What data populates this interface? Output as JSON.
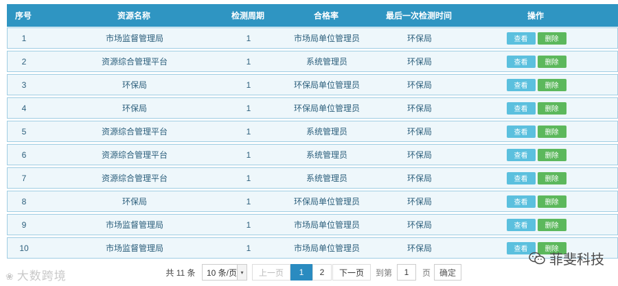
{
  "table": {
    "headers": [
      "序号",
      "资源名称",
      "检测周期",
      "合格率",
      "最后一次检测时间",
      "操作"
    ],
    "view_label": "查看",
    "delete_label": "删除",
    "rows": [
      {
        "no": "1",
        "name": "市场监督管理局",
        "cycle": "1",
        "rate": "市场局单位管理员",
        "last": "环保局"
      },
      {
        "no": "2",
        "name": "资源综合管理平台",
        "cycle": "1",
        "rate": "系统管理员",
        "last": "环保局"
      },
      {
        "no": "3",
        "name": "环保局",
        "cycle": "1",
        "rate": "环保局单位管理员",
        "last": "环保局"
      },
      {
        "no": "4",
        "name": "环保局",
        "cycle": "1",
        "rate": "环保局单位管理员",
        "last": "环保局"
      },
      {
        "no": "5",
        "name": "资源综合管理平台",
        "cycle": "1",
        "rate": "系统管理员",
        "last": "环保局"
      },
      {
        "no": "6",
        "name": "资源综合管理平台",
        "cycle": "1",
        "rate": "系统管理员",
        "last": "环保局"
      },
      {
        "no": "7",
        "name": "资源综合管理平台",
        "cycle": "1",
        "rate": "系统管理员",
        "last": "环保局"
      },
      {
        "no": "8",
        "name": "环保局",
        "cycle": "1",
        "rate": "环保局单位管理员",
        "last": "环保局"
      },
      {
        "no": "9",
        "name": "市场监督管理局",
        "cycle": "1",
        "rate": "市场局单位管理员",
        "last": "环保局"
      },
      {
        "no": "10",
        "name": "市场监督管理局",
        "cycle": "1",
        "rate": "市场局单位管理员",
        "last": "环保局"
      }
    ]
  },
  "pagination": {
    "total": "共 11 条",
    "page_size": "10 条/页",
    "prev": "上一页",
    "pages": [
      "1",
      "2"
    ],
    "next": "下一页",
    "goto_label": "到第",
    "goto_value": "1",
    "page_unit": "页",
    "confirm": "确定"
  },
  "watermarks": {
    "left": "大数跨境",
    "right": "菲斐科技"
  },
  "colors": {
    "header_bg": "#2f95c2",
    "row_bg": "#eef7fb",
    "view_button": "#5bc0de",
    "delete_button": "#5cb85c",
    "active_page": "#2a8bc0"
  }
}
